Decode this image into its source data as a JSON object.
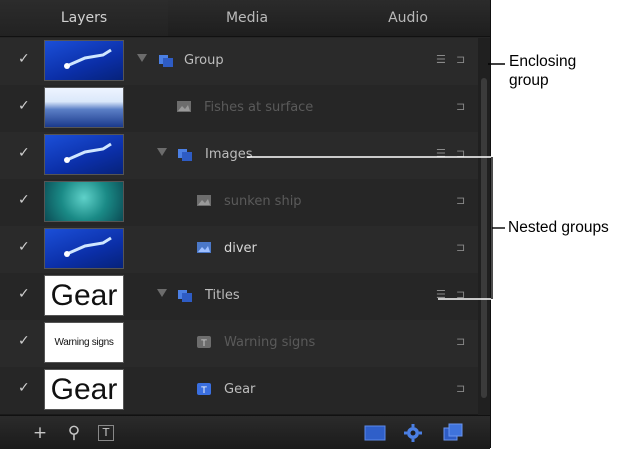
{
  "tabs": [
    "Layers",
    "Media",
    "Audio"
  ],
  "rows": [
    {
      "label": "Group",
      "thumb": "diver",
      "kind": "group"
    },
    {
      "label": "Fishes at surface",
      "thumb": "fish",
      "kind": "image"
    },
    {
      "label": "Images",
      "thumb": "diver",
      "kind": "group"
    },
    {
      "label": "sunken ship",
      "thumb": "ship",
      "kind": "image"
    },
    {
      "label": "diver",
      "thumb": "diver",
      "kind": "image"
    },
    {
      "label": "Titles",
      "thumb_text": "Gear",
      "kind": "group"
    },
    {
      "label": "Warning signs",
      "thumb_text": "Warning signs",
      "kind": "text"
    },
    {
      "label": "Gear",
      "thumb_text": "Gear",
      "kind": "text"
    }
  ],
  "check_glyph": "✓",
  "bottom_tools": {
    "add": "+",
    "search": "⚲",
    "text": "T"
  },
  "annotations": {
    "enclosing_line1": "Enclosing",
    "enclosing_line2": "group",
    "nested": "Nested groups"
  },
  "colors": {
    "accent": "#3a6fe0",
    "panel": "#252525",
    "text": "#d8d8d8"
  }
}
